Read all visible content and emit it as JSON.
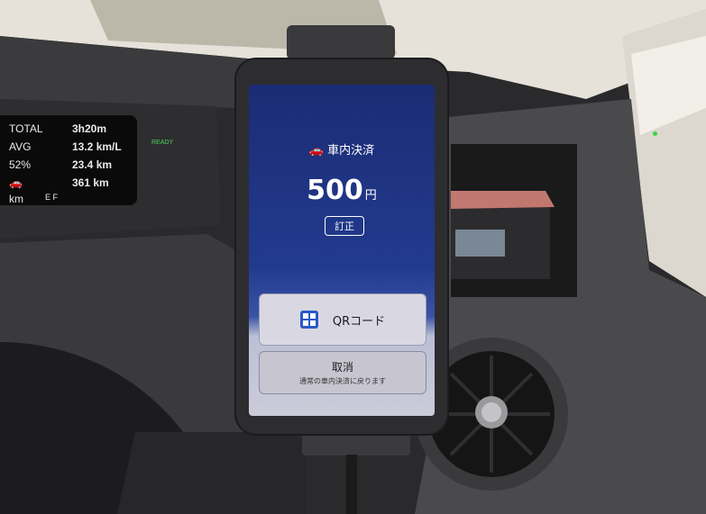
{
  "dashboard": {
    "rows": [
      {
        "label": "TOTAL",
        "value": "3h20m"
      },
      {
        "label": "AVG",
        "value": "13.2 km/L"
      },
      {
        "label": "52%",
        "value": "23.4 km"
      },
      {
        "label": "",
        "value": "361 km"
      },
      {
        "label": "km",
        "value": "E     F"
      }
    ],
    "ready": "READY"
  },
  "app": {
    "header": "車内決済",
    "amount": "500",
    "currency": "円",
    "correct_label": "訂正",
    "qr_label": "QRコード",
    "cancel_label": "取消",
    "cancel_sub": "通常の車内決済に戻ります"
  },
  "colors": {
    "screen_blue": "#223a8e",
    "qr_icon": "#2a59c9",
    "indicator_green": "#3fd34a"
  }
}
